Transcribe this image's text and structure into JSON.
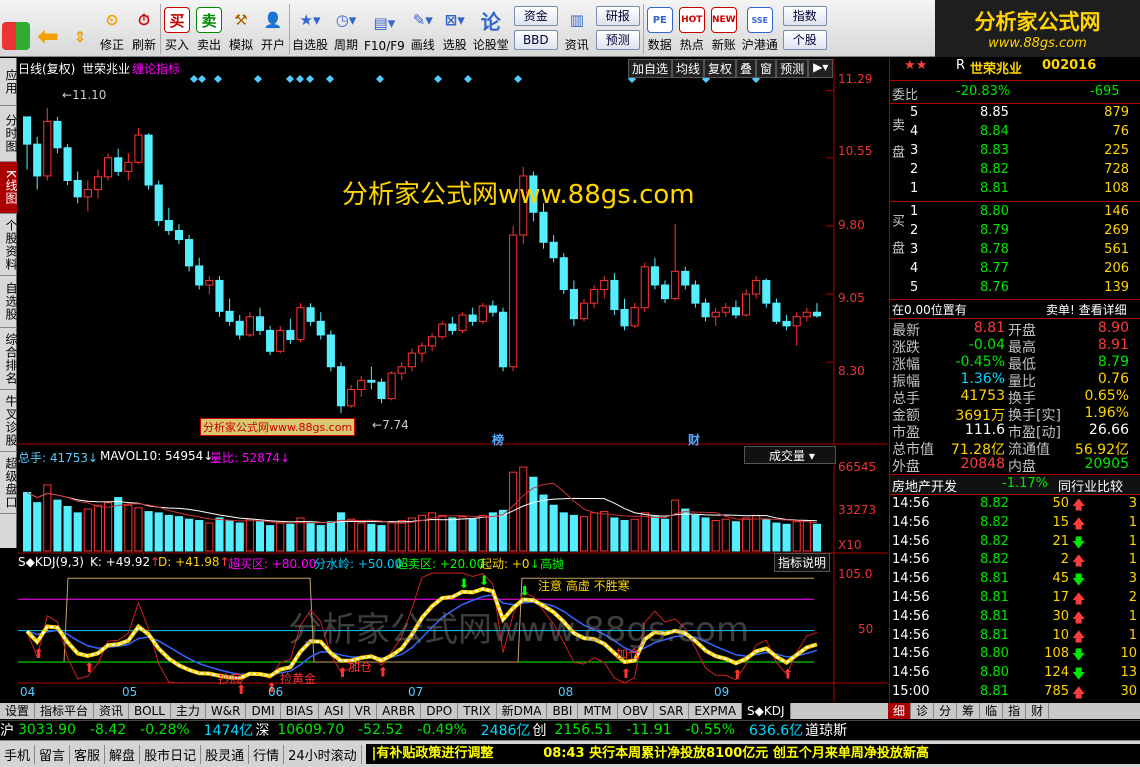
{
  "toolbar": {
    "buttons": [
      "",
      "",
      "",
      "",
      "修正",
      "刷新",
      "买入",
      "卖出",
      "模拟",
      "开户",
      "自选股",
      "周期",
      "F10/F9",
      "画线",
      "选股",
      "论股堂",
      "资讯",
      "",
      "",
      "数据",
      "热点",
      "新账",
      "沪港通"
    ],
    "box1": [
      "资金",
      "BBD"
    ],
    "box2": [
      "研报",
      "预测"
    ],
    "box3": [
      "指数",
      "个股"
    ]
  },
  "logo": {
    "title": "分析家公式网",
    "url": "www.88gs.com"
  },
  "sidebar": {
    "tabs": [
      "应用",
      "分时图",
      "K线图",
      "个股资料",
      "自选股",
      "综合排名",
      "牛叉诊股",
      "超级盘口"
    ]
  },
  "chart": {
    "header": {
      "period": "日线(复权)",
      "name": "世荣兆业",
      "indicator": "缠论指标"
    },
    "header_buttons": [
      "加自选",
      "均线",
      "复权",
      "叠",
      "窗",
      "预测"
    ],
    "price_axis": [
      "11.29",
      "10.55",
      "9.80",
      "9.05",
      "8.30"
    ],
    "high_label": "11.10",
    "low_label": "7.74",
    "watermark": "分析家公式网www.88gs.com",
    "small_watermark": "分析家公式网www.88gs.com",
    "markers": [
      "榜",
      "财"
    ],
    "volume": {
      "total": "总手: 41753",
      "mavol": "MAVOL10: 54954",
      "ratio": "量比: 52874",
      "axis": [
        "66545",
        "33273",
        "X10"
      ],
      "selector": "成交量"
    },
    "kdj": {
      "title": "S◆KDJ(9,3)",
      "k": "K: +49.92",
      "d": "D: +41.98",
      "buy": "超买区: +80.00",
      "div": "分水岭: +50.00",
      "sell": "超卖区: +20.00",
      "start": "起动: +0",
      "high": "高抛",
      "axis": [
        "105.0",
        "50"
      ],
      "btn": "指标说明",
      "notes": [
        "注意 高虚 不胜寒",
        "抄底",
        "捡黄金",
        "加仓",
        "加仓"
      ],
      "wm": "分析家公式网www.88gs.com"
    },
    "months": [
      "04",
      "05",
      "06",
      "07",
      "08",
      "09"
    ],
    "tabs": [
      "设置",
      "指标平台",
      "资讯",
      "BOLL",
      "主力",
      "W&R",
      "DMI",
      "BIAS",
      "ASI",
      "VR",
      "ARBR",
      "DPO",
      "TRIX",
      "新DMA",
      "BBI",
      "MTM",
      "OBV",
      "SAR",
      "EXPMA",
      "S◆KDJ"
    ]
  },
  "quote": {
    "title": "世荣兆业",
    "code": "002016",
    "prefix": "R",
    "weibi": {
      "label": "委比",
      "pct": "-20.83%",
      "val": "-695"
    },
    "sell_label": "卖盘",
    "buy_label": "买盘",
    "sells": [
      {
        "n": "5",
        "p": "8.85",
        "v": "879"
      },
      {
        "n": "4",
        "p": "8.84",
        "v": "76"
      },
      {
        "n": "3",
        "p": "8.83",
        "v": "225"
      },
      {
        "n": "2",
        "p": "8.82",
        "v": "728"
      },
      {
        "n": "1",
        "p": "8.81",
        "v": "108"
      }
    ],
    "buys": [
      {
        "n": "1",
        "p": "8.80",
        "v": "146"
      },
      {
        "n": "2",
        "p": "8.79",
        "v": "269"
      },
      {
        "n": "3",
        "p": "8.78",
        "v": "561"
      },
      {
        "n": "4",
        "p": "8.77",
        "v": "206"
      },
      {
        "n": "5",
        "p": "8.76",
        "v": "139"
      }
    ],
    "pos_note": "在0.00位置有",
    "detail_btn": "卖单! 查看详细",
    "stats": [
      {
        "l1": "最新",
        "v1": "8.81",
        "l2": "开盘",
        "v2": "8.90"
      },
      {
        "l1": "涨跌",
        "v1": "-0.04",
        "l2": "最高",
        "v2": "8.91"
      },
      {
        "l1": "涨幅",
        "v1": "-0.45%",
        "l2": "最低",
        "v2": "8.79"
      },
      {
        "l1": "振幅",
        "v1": "1.36%",
        "l2": "量比",
        "v2": "0.76"
      },
      {
        "l1": "总手",
        "v1": "41753",
        "l2": "换手",
        "v2": "0.65%"
      },
      {
        "l1": "金额",
        "v1": "3691万",
        "l2": "换手[实]",
        "v2": "1.96%"
      },
      {
        "l1": "市盈",
        "v1": "111.6",
        "l2": "市盈[动]",
        "v2": "26.66"
      },
      {
        "l1": "总市值",
        "v1": "71.28亿",
        "l2": "流通值",
        "v2": "56.92亿"
      },
      {
        "l1": "外盘",
        "v1": "20848",
        "l2": "内盘",
        "v2": "20905"
      }
    ],
    "sector": {
      "name": "房地产开发",
      "pct": "-1.17%",
      "cmp": "同行业比较"
    },
    "ticks": [
      {
        "t": "14:56",
        "p": "8.82",
        "v": "50",
        "n": "3",
        "dir": "up"
      },
      {
        "t": "14:56",
        "p": "8.82",
        "v": "15",
        "n": "1",
        "dir": "up"
      },
      {
        "t": "14:56",
        "p": "8.82",
        "v": "21",
        "n": "1",
        "dir": "down"
      },
      {
        "t": "14:56",
        "p": "8.82",
        "v": "2",
        "n": "1",
        "dir": "up"
      },
      {
        "t": "14:56",
        "p": "8.81",
        "v": "45",
        "n": "3",
        "dir": "down"
      },
      {
        "t": "14:56",
        "p": "8.81",
        "v": "17",
        "n": "2",
        "dir": "up"
      },
      {
        "t": "14:56",
        "p": "8.81",
        "v": "30",
        "n": "1",
        "dir": "up"
      },
      {
        "t": "14:56",
        "p": "8.81",
        "v": "10",
        "n": "1",
        "dir": "up"
      },
      {
        "t": "14:56",
        "p": "8.80",
        "v": "108",
        "n": "10",
        "dir": "down"
      },
      {
        "t": "14:56",
        "p": "8.80",
        "v": "124",
        "n": "13",
        "dir": "down"
      },
      {
        "t": "15:00",
        "p": "8.81",
        "v": "785",
        "n": "30",
        "dir": "up"
      }
    ],
    "tabs": [
      "细",
      "诊",
      "分",
      "筹",
      "临",
      "指",
      "财"
    ]
  },
  "indexbar": [
    {
      "name": "沪",
      "v": "3033.90",
      "c": "-8.42",
      "p": "-0.28%",
      "a": "1474亿"
    },
    {
      "name": "深",
      "v": "10609.70",
      "c": "-52.52",
      "p": "-0.49%",
      "a": "2486亿"
    },
    {
      "name": "创",
      "v": "2156.51",
      "c": "-11.91",
      "p": "-0.55%",
      "a": "636.6亿"
    },
    {
      "name": "道琼斯",
      "v": "",
      "c": "",
      "p": "",
      "a": ""
    }
  ],
  "status": {
    "items": [
      "手机",
      "留言",
      "客服",
      "解盘",
      "股市日记",
      "股灵通",
      "行情",
      "24小时滚动"
    ],
    "news1": "|有补贴政策进行调整",
    "news2": "08:43 央行本周累计净投放8100亿元 创五个月来单周净投放新高"
  },
  "chart_data": {
    "type": "candlestick",
    "ohlc": [
      [
        11.0,
        11.0,
        10.42,
        10.7
      ],
      [
        10.7,
        10.78,
        10.2,
        10.35
      ],
      [
        10.35,
        11.1,
        10.3,
        10.95
      ],
      [
        10.95,
        11.0,
        10.6,
        10.66
      ],
      [
        10.66,
        10.7,
        10.25,
        10.3
      ],
      [
        10.3,
        10.4,
        10.05,
        10.12
      ],
      [
        10.12,
        10.3,
        9.96,
        10.2
      ],
      [
        10.2,
        10.42,
        10.1,
        10.34
      ],
      [
        10.34,
        10.6,
        10.3,
        10.55
      ],
      [
        10.55,
        10.65,
        10.35,
        10.4
      ],
      [
        10.4,
        10.6,
        10.3,
        10.5
      ],
      [
        10.5,
        10.88,
        10.48,
        10.8
      ],
      [
        10.8,
        10.82,
        10.2,
        10.25
      ],
      [
        10.25,
        10.3,
        9.8,
        9.86
      ],
      [
        9.86,
        10.0,
        9.7,
        9.75
      ],
      [
        9.75,
        9.82,
        9.6,
        9.65
      ],
      [
        9.65,
        9.7,
        9.3,
        9.36
      ],
      [
        9.36,
        9.45,
        9.1,
        9.15
      ],
      [
        9.15,
        9.25,
        9.05,
        9.2
      ],
      [
        9.2,
        9.25,
        8.8,
        8.86
      ],
      [
        8.86,
        9.0,
        8.7,
        8.75
      ],
      [
        8.75,
        8.82,
        8.55,
        8.6
      ],
      [
        8.6,
        8.85,
        8.58,
        8.8
      ],
      [
        8.8,
        8.9,
        8.6,
        8.65
      ],
      [
        8.65,
        8.7,
        8.38,
        8.42
      ],
      [
        8.42,
        8.7,
        8.4,
        8.65
      ],
      [
        8.65,
        8.78,
        8.5,
        8.55
      ],
      [
        8.55,
        8.95,
        8.52,
        8.9
      ],
      [
        8.9,
        8.95,
        8.7,
        8.75
      ],
      [
        8.75,
        8.85,
        8.55,
        8.6
      ],
      [
        8.6,
        8.65,
        8.2,
        8.25
      ],
      [
        8.25,
        8.3,
        7.74,
        7.82
      ],
      [
        7.82,
        8.05,
        7.8,
        8.0
      ],
      [
        8.0,
        8.15,
        7.92,
        8.1
      ],
      [
        8.1,
        8.25,
        8.0,
        8.08
      ],
      [
        8.08,
        8.12,
        7.85,
        7.9
      ],
      [
        7.9,
        8.2,
        7.88,
        8.18
      ],
      [
        8.18,
        8.3,
        8.1,
        8.25
      ],
      [
        8.25,
        8.45,
        8.2,
        8.4
      ],
      [
        8.4,
        8.52,
        8.3,
        8.48
      ],
      [
        8.48,
        8.62,
        8.42,
        8.58
      ],
      [
        8.58,
        8.75,
        8.55,
        8.72
      ],
      [
        8.72,
        8.8,
        8.6,
        8.65
      ],
      [
        8.65,
        8.85,
        8.62,
        8.82
      ],
      [
        8.82,
        8.9,
        8.7,
        8.75
      ],
      [
        8.75,
        8.95,
        8.72,
        8.92
      ],
      [
        8.92,
        8.98,
        8.8,
        8.85
      ],
      [
        8.85,
        8.9,
        8.2,
        8.25
      ],
      [
        8.25,
        9.8,
        8.2,
        9.7
      ],
      [
        9.7,
        10.45,
        9.6,
        10.35
      ],
      [
        10.35,
        10.4,
        9.85,
        9.95
      ],
      [
        9.95,
        10.05,
        9.55,
        9.62
      ],
      [
        9.62,
        9.7,
        9.4,
        9.45
      ],
      [
        9.45,
        9.5,
        9.05,
        9.1
      ],
      [
        9.1,
        9.2,
        8.7,
        8.78
      ],
      [
        8.78,
        9.0,
        8.75,
        8.95
      ],
      [
        8.95,
        9.15,
        8.9,
        9.1
      ],
      [
        9.1,
        9.25,
        9.0,
        9.2
      ],
      [
        9.2,
        9.28,
        8.82,
        8.88
      ],
      [
        8.88,
        9.0,
        8.65,
        8.7
      ],
      [
        8.7,
        8.95,
        8.68,
        8.9
      ],
      [
        8.9,
        9.4,
        8.85,
        9.35
      ],
      [
        9.35,
        9.45,
        9.1,
        9.15
      ],
      [
        9.15,
        9.2,
        8.95,
        9.0
      ],
      [
        9.0,
        9.82,
        8.98,
        9.3
      ],
      [
        9.3,
        9.35,
        9.1,
        9.15
      ],
      [
        9.15,
        9.2,
        8.9,
        8.95
      ],
      [
        8.95,
        9.0,
        8.75,
        8.8
      ],
      [
        8.8,
        8.9,
        8.7,
        8.85
      ],
      [
        8.85,
        8.95,
        8.8,
        8.9
      ],
      [
        8.9,
        8.98,
        8.78,
        8.82
      ],
      [
        8.82,
        9.1,
        8.8,
        9.05
      ],
      [
        9.05,
        9.25,
        9.0,
        9.2
      ],
      [
        9.2,
        9.22,
        8.9,
        8.95
      ],
      [
        8.95,
        9.0,
        8.72,
        8.75
      ],
      [
        8.75,
        8.82,
        8.65,
        8.7
      ],
      [
        8.7,
        8.85,
        8.48,
        8.8
      ],
      [
        8.8,
        8.9,
        8.75,
        8.85
      ],
      [
        8.85,
        8.95,
        8.79,
        8.81
      ]
    ],
    "price_range": [
      7.4,
      11.45
    ],
    "volume": [
      46000,
      38000,
      52000,
      40000,
      35000,
      30000,
      33000,
      36000,
      38000,
      42000,
      36000,
      34000,
      31000,
      30000,
      28000,
      27000,
      25000,
      24000,
      22000,
      26000,
      24000,
      22000,
      25000,
      23000,
      20000,
      22000,
      21000,
      26000,
      22000,
      20000,
      23000,
      30000,
      25000,
      22000,
      21000,
      20000,
      22000,
      24000,
      26000,
      28000,
      30000,
      28000,
      26000,
      27000,
      25000,
      28000,
      30000,
      32000,
      62000,
      66000,
      58000,
      44000,
      36000,
      30000,
      28000,
      27000,
      30000,
      31000,
      26000,
      24000,
      25000,
      30000,
      27000,
      25000,
      40000,
      33000,
      28000,
      26000,
      24000,
      25000,
      23000,
      26000,
      28000,
      25000,
      22000,
      21000,
      23000,
      24000,
      21000
    ],
    "volume_range": [
      0,
      70000
    ]
  }
}
